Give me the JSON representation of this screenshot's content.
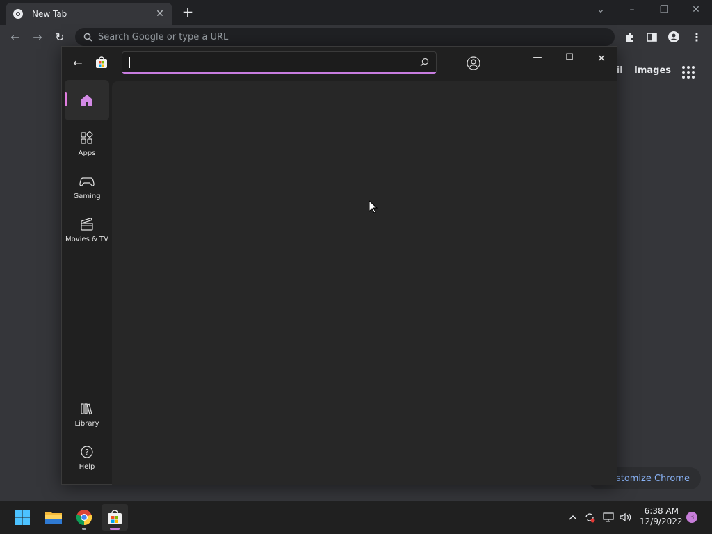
{
  "browser": {
    "tab_title": "New Tab",
    "omnibox_placeholder": "Search Google or type a URL",
    "page_links": [
      "ail",
      "Images"
    ],
    "customize_label": "ustomize Chrome"
  },
  "store": {
    "search_value": "",
    "nav": {
      "apps": "Apps",
      "gaming": "Gaming",
      "movies": "Movies & TV",
      "library": "Library",
      "help": "Help"
    },
    "accent": "#c87de0"
  },
  "taskbar": {
    "time": "6:38 AM",
    "date": "12/9/2022",
    "notification_count": "3"
  }
}
